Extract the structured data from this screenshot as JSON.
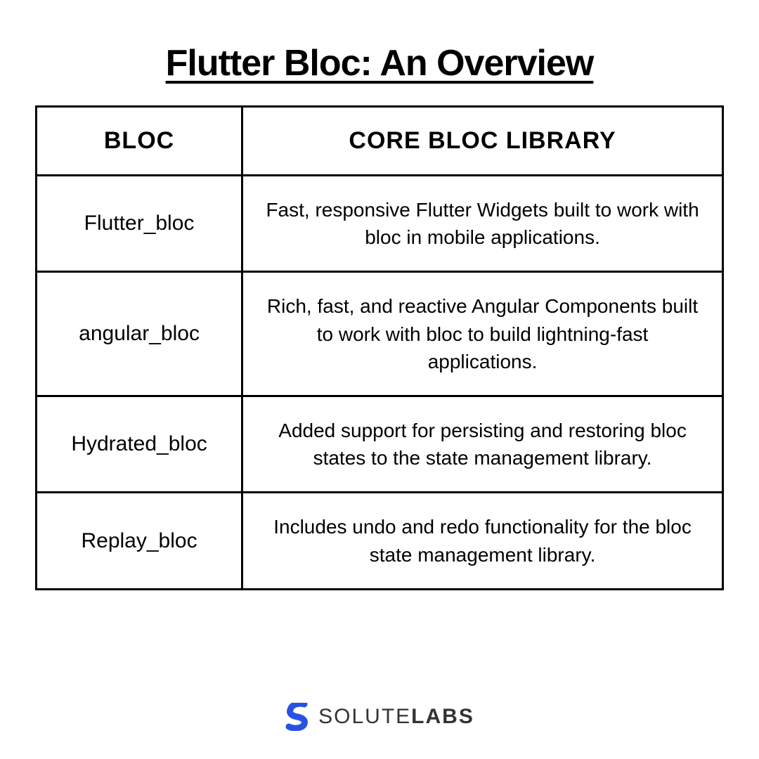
{
  "chart_data": {
    "type": "table",
    "title": "Flutter Bloc: An Overview",
    "columns": [
      "BLOC",
      "CORE BLOC LIBRARY"
    ],
    "rows": [
      [
        "Flutter_bloc",
        "Fast, responsive Flutter Widgets built to work with bloc in mobile applications."
      ],
      [
        "angular_bloc",
        "Rich, fast, and reactive Angular Components built to work with bloc to build lightning-fast applications."
      ],
      [
        "Hydrated_bloc",
        "Added support for persisting and restoring bloc states to the state management library."
      ],
      [
        "Replay_bloc",
        "Includes undo and redo functionality for the bloc state management library."
      ]
    ]
  },
  "title": "Flutter Bloc: An Overview",
  "table": {
    "headers": {
      "col1": "BLOC",
      "col2": "CORE BLOC LIBRARY"
    },
    "rows": [
      {
        "bloc": "Flutter_bloc",
        "desc": "Fast, responsive Flutter Widgets built to work with bloc in mobile applications."
      },
      {
        "bloc": "angular_bloc",
        "desc": "Rich, fast, and reactive Angular Components built to work with bloc to build lightning-fast applications."
      },
      {
        "bloc": "Hydrated_bloc",
        "desc": "Added support for persisting and restoring bloc states to the state management library."
      },
      {
        "bloc": "Replay_bloc",
        "desc": "Includes undo and redo functionality for the bloc state management library."
      }
    ]
  },
  "footer": {
    "brand_part1": "SOLUTE",
    "brand_part2": "LABS",
    "brand_color": "#2952E3"
  }
}
